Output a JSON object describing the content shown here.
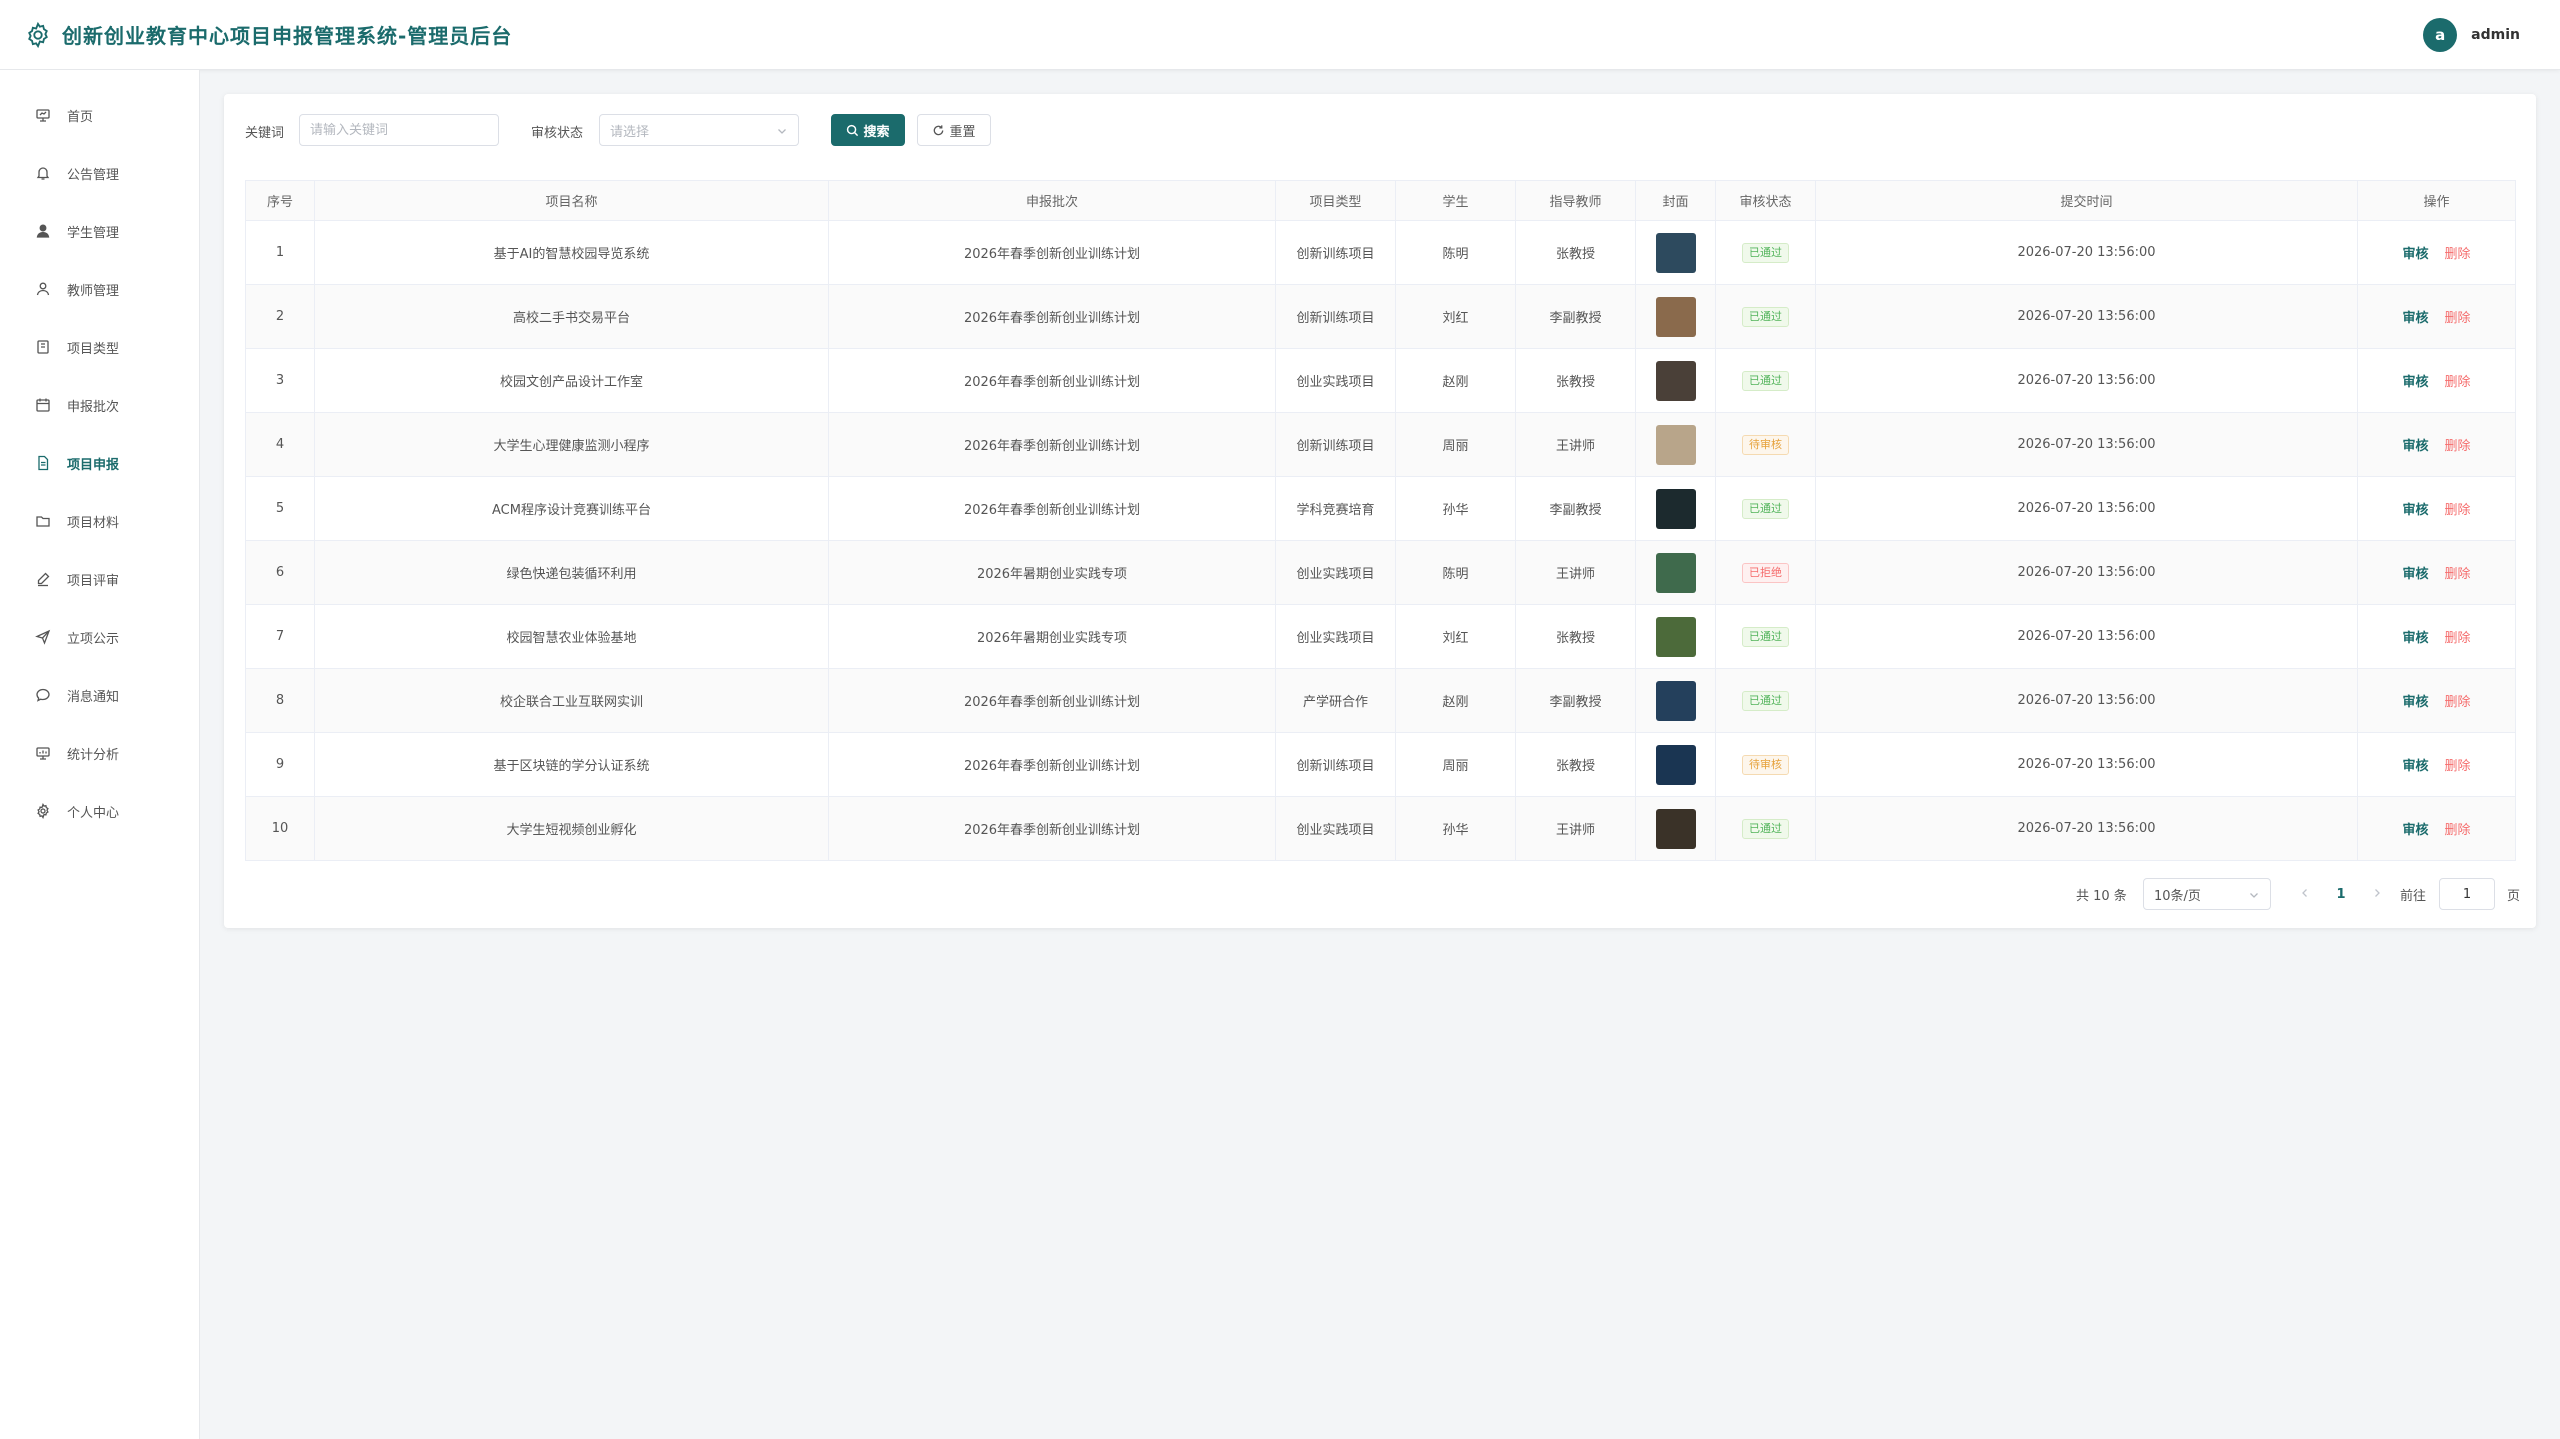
{
  "header": {
    "title": "创新创业教育中心项目申报管理系统-管理员后台",
    "logo_icon": "gear-icon",
    "user": {
      "avatar_letter": "a",
      "name": "admin"
    }
  },
  "sidebar": {
    "items": [
      {
        "label": "首页",
        "icon": "dashboard-icon",
        "active": false
      },
      {
        "label": "公告管理",
        "icon": "bell-icon",
        "active": false
      },
      {
        "label": "学生管理",
        "icon": "user-filled-icon",
        "active": false
      },
      {
        "label": "教师管理",
        "icon": "user-icon",
        "active": false
      },
      {
        "label": "项目类型",
        "icon": "notebook-icon",
        "active": false
      },
      {
        "label": "申报批次",
        "icon": "calendar-icon",
        "active": false
      },
      {
        "label": "项目申报",
        "icon": "document-icon",
        "active": true
      },
      {
        "label": "项目材料",
        "icon": "folder-icon",
        "active": false
      },
      {
        "label": "项目评审",
        "icon": "edit-pen-icon",
        "active": false
      },
      {
        "label": "立项公示",
        "icon": "send-icon",
        "active": false
      },
      {
        "label": "消息通知",
        "icon": "chat-icon",
        "active": false
      },
      {
        "label": "统计分析",
        "icon": "chart-icon",
        "active": false
      },
      {
        "label": "个人中心",
        "icon": "settings-icon",
        "active": false
      }
    ]
  },
  "filters": {
    "keyword_label": "关键词",
    "keyword_placeholder": "请输入关键词",
    "keyword_value": "",
    "status_label": "审核状态",
    "status_placeholder": "请选择",
    "search_label": "搜索",
    "reset_label": "重置"
  },
  "table": {
    "columns": [
      "序号",
      "项目名称",
      "申报批次",
      "项目类型",
      "学生",
      "指导教师",
      "封面",
      "审核状态",
      "提交时间",
      "操作"
    ],
    "review_label": "审核",
    "delete_label": "删除",
    "rows": [
      {
        "index": "1",
        "name": "基于AI的智慧校园导览系统",
        "batch": "2026年春季创新创业训练计划",
        "type": "创新训练项目",
        "student": "陈明",
        "teacher": "张教授",
        "status": "已通过",
        "status_kind": "ok",
        "time": "2026-07-20 13:56:00",
        "cover_color": "#2d4a5e"
      },
      {
        "index": "2",
        "name": "高校二手书交易平台",
        "batch": "2026年春季创新创业训练计划",
        "type": "创新训练项目",
        "student": "刘红",
        "teacher": "李副教授",
        "status": "已通过",
        "status_kind": "ok",
        "time": "2026-07-20 13:56:00",
        "cover_color": "#8a6a4c"
      },
      {
        "index": "3",
        "name": "校园文创产品设计工作室",
        "batch": "2026年春季创新创业训练计划",
        "type": "创业实践项目",
        "student": "赵刚",
        "teacher": "张教授",
        "status": "已通过",
        "status_kind": "ok",
        "time": "2026-07-20 13:56:00",
        "cover_color": "#4a4038"
      },
      {
        "index": "4",
        "name": "大学生心理健康监测小程序",
        "batch": "2026年春季创新创业训练计划",
        "type": "创新训练项目",
        "student": "周丽",
        "teacher": "王讲师",
        "status": "待审核",
        "status_kind": "pend",
        "time": "2026-07-20 13:56:00",
        "cover_color": "#b8a58a"
      },
      {
        "index": "5",
        "name": "ACM程序设计竞赛训练平台",
        "batch": "2026年春季创新创业训练计划",
        "type": "学科竞赛培育",
        "student": "孙华",
        "teacher": "李副教授",
        "status": "已通过",
        "status_kind": "ok",
        "time": "2026-07-20 13:56:00",
        "cover_color": "#1c2a2e"
      },
      {
        "index": "6",
        "name": "绿色快递包装循环利用",
        "batch": "2026年暑期创业实践专项",
        "type": "创业实践项目",
        "student": "陈明",
        "teacher": "王讲师",
        "status": "已拒绝",
        "status_kind": "rej",
        "time": "2026-07-20 13:56:00",
        "cover_color": "#3f6a4c"
      },
      {
        "index": "7",
        "name": "校园智慧农业体验基地",
        "batch": "2026年暑期创业实践专项",
        "type": "创业实践项目",
        "student": "刘红",
        "teacher": "张教授",
        "status": "已通过",
        "status_kind": "ok",
        "time": "2026-07-20 13:56:00",
        "cover_color": "#4c6a3a"
      },
      {
        "index": "8",
        "name": "校企联合工业互联网实训",
        "batch": "2026年春季创新创业训练计划",
        "type": "产学研合作",
        "student": "赵刚",
        "teacher": "李副教授",
        "status": "已通过",
        "status_kind": "ok",
        "time": "2026-07-20 13:56:00",
        "cover_color": "#24405c"
      },
      {
        "index": "9",
        "name": "基于区块链的学分认证系统",
        "batch": "2026年春季创新创业训练计划",
        "type": "创新训练项目",
        "student": "周丽",
        "teacher": "张教授",
        "status": "待审核",
        "status_kind": "pend",
        "time": "2026-07-20 13:56:00",
        "cover_color": "#1a3552"
      },
      {
        "index": "10",
        "name": "大学生短视频创业孵化",
        "batch": "2026年春季创新创业训练计划",
        "type": "创业实践项目",
        "student": "孙华",
        "teacher": "王讲师",
        "status": "已通过",
        "status_kind": "ok",
        "time": "2026-07-20 13:56:00",
        "cover_color": "#3a3228"
      }
    ]
  },
  "pagination": {
    "total_text": "共 10 条",
    "page_size": "10条/页",
    "current_page": "1",
    "goto_label": "前往",
    "goto_value": "1",
    "page_suffix": "页"
  },
  "colors": {
    "brand": "#1b6b6c",
    "danger": "#f56c6c",
    "success": "#52b45b",
    "warning": "#e6a23c"
  }
}
